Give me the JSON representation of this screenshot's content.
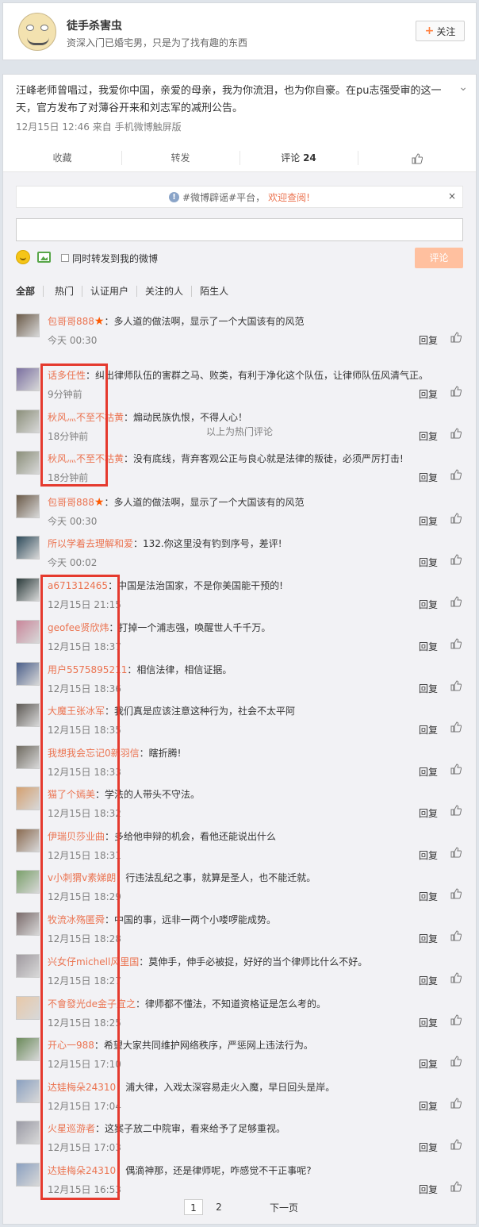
{
  "profile": {
    "name": "徒手杀害虫",
    "bio": "资深入门已婚宅男，只是为了找有趣的东西",
    "follow_label": "关注"
  },
  "post": {
    "text": "汪峰老师曾唱过，我爱你中国，亲爱的母亲，我为你流泪，也为你自豪。在pu志强受审的这一天，官方发布了对薄谷开来和刘志军的减刑公告。",
    "meta": "12月15日 12:46 来自 手机微博触屏版",
    "actions": {
      "favorite": "收藏",
      "repost": "转发",
      "comment": "评论",
      "comment_count": "24"
    }
  },
  "comment_box": {
    "rumor_notice": "#微博辟谣#平台，",
    "rumor_link": "欢迎查阅!",
    "close_glyph": "×",
    "repost_label": "同时转发到我的微博",
    "submit_label": "评论"
  },
  "filters": [
    "全部",
    "热门",
    "认证用户",
    "关注的人",
    "陌生人"
  ],
  "hot_separator": "以上为热门评论",
  "reply_label": "回复",
  "comments": [
    {
      "user": "包哥哥888",
      "star": true,
      "text": "：多人道的做法啊，显示了一个大国该有的风范",
      "time": "今天 00:30",
      "avatar": "#6b5a48"
    },
    {
      "user": "话多任性",
      "star": false,
      "text": "：纠出律师队伍的害群之马、败类，有利于净化这个队伍，让律师队伍风清气正。",
      "time": "9分钟前",
      "avatar": "#7a6fa0"
    },
    {
      "user": "秋风灬不至不枯黄",
      "star": false,
      "text": "：煽动民族仇恨，不得人心！",
      "time": "18分钟前",
      "avatar": "#8b8f7a"
    },
    {
      "user": "秋风灬不至不枯黄",
      "star": false,
      "text": "：没有底线，背弃客观公正与良心就是法律的叛徒，必须严厉打击!",
      "time": "18分钟前",
      "avatar": "#8b8f7a"
    },
    {
      "user": "包哥哥888",
      "star": true,
      "text": "：多人道的做法啊，显示了一个大国该有的风范",
      "time": "今天 00:30",
      "avatar": "#6b5a48"
    },
    {
      "user": "所以学着去理解和爱",
      "star": false,
      "text": "：132.你这里没有钓到序号，差评!",
      "time": "今天 00:02",
      "avatar": "#2d4a5a"
    },
    {
      "user": "a671312465",
      "star": false,
      "text": "：中国是法治国家，不是你美国能干预的!",
      "time": "12月15日 21:15",
      "avatar": "#2a3a3a"
    },
    {
      "user": "geofee贤欣炜",
      "star": false,
      "text": "：打掉一个浦志强，唤醒世人千千万。",
      "time": "12月15日 18:37",
      "avatar": "#c9869a"
    },
    {
      "user": "用户5575895211",
      "star": false,
      "text": "：相信法律，相信证据。",
      "time": "12月15日 18:36",
      "avatar": "#4a5e8a"
    },
    {
      "user": "大魔王张冰军",
      "star": false,
      "text": "：我们真是应该注意这种行为，社会不太平阿",
      "time": "12月15日 18:35",
      "avatar": "#5e5a55"
    },
    {
      "user": "我想我会忘记0新羽信",
      "star": false,
      "text": "：瞎折腾!",
      "time": "12月15日 18:33",
      "avatar": "#6f6a60"
    },
    {
      "user": "猫了个嫣美",
      "star": false,
      "text": "：学法的人带头不守法。",
      "time": "12月15日 18:32",
      "avatar": "#d4a070"
    },
    {
      "user": "伊瑞贝莎业曲",
      "star": false,
      "text": "：多给他申辩的机会，看他还能说出什么",
      "time": "12月15日 18:31",
      "avatar": "#8a6a50"
    },
    {
      "user": "v小刺猬v素娣朗",
      "star": false,
      "text": "：行违法乱纪之事，就算是圣人，也不能迁就。",
      "time": "12月15日 18:29",
      "avatar": "#7aa06a"
    },
    {
      "user": "牧流冰殇匿舜",
      "star": false,
      "text": "：中国的事，远非一两个小喽啰能成势。",
      "time": "12月15日 18:28",
      "avatar": "#7a6a6a"
    },
    {
      "user": "兴女仔michell风里国",
      "star": false,
      "text": "：莫伸手，伸手必被捉，好好的当个律师比什么不好。",
      "time": "12月15日 18:27",
      "avatar": "#a09aa0"
    },
    {
      "user": "不會發光de金子宜之",
      "star": false,
      "text": "：律师都不懂法，不知道资格证是怎么考的。",
      "time": "12月15日 18:25",
      "avatar": "#e8c8a8"
    },
    {
      "user": "开心一988",
      "star": false,
      "text": "：希望大家共同维护网络秩序，严惩网上违法行为。",
      "time": "12月15日 17:10",
      "avatar": "#6a8a5a"
    },
    {
      "user": "达娃梅朵24310",
      "star": false,
      "text": "：浦大律，入戏太深容易走火入魔，早日回头是岸。",
      "time": "12月15日 17:04",
      "avatar": "#8aa0c0"
    },
    {
      "user": "火星巡游者",
      "star": false,
      "text": "：这案子放二中院审，看来给予了足够重视。",
      "time": "12月15日 17:03",
      "avatar": "#9a9aa5"
    },
    {
      "user": "达娃梅朵24310",
      "star": false,
      "text": "：偶滴神那，还是律师呢，咋感觉不干正事呢?",
      "time": "12月15日 16:53",
      "avatar": "#8aa0c0"
    }
  ],
  "pager": {
    "page1": "1",
    "page2": "2",
    "next": "下一页"
  }
}
